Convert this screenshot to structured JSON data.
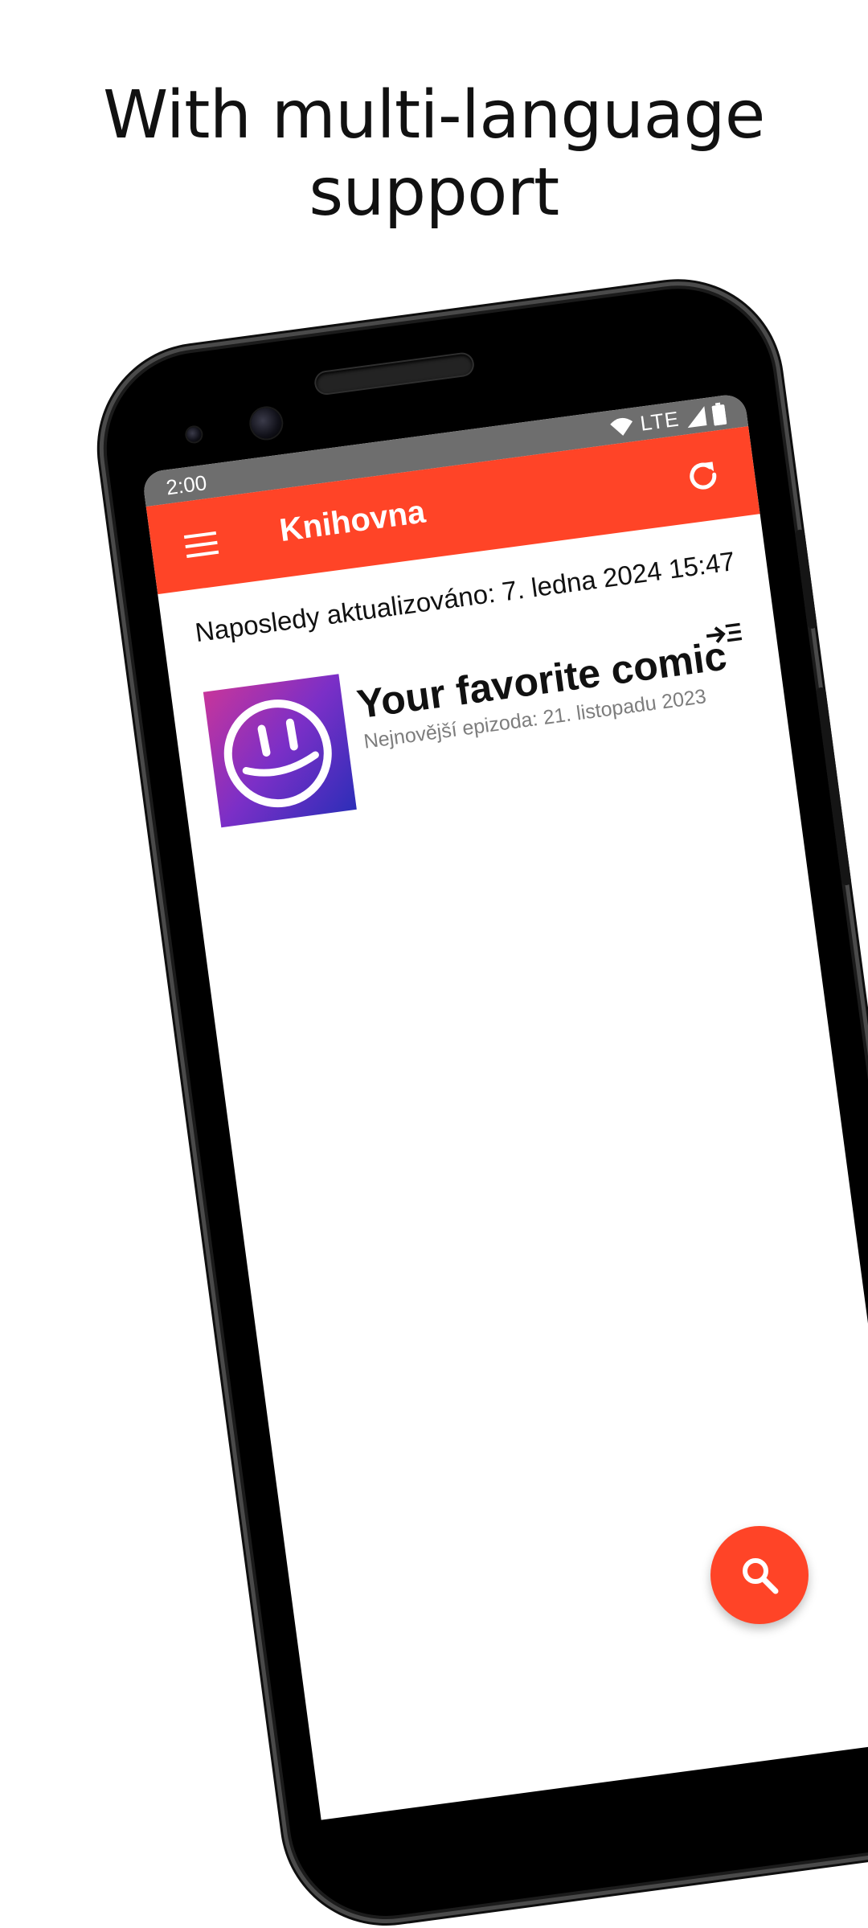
{
  "promo": {
    "headline_line1": "With multi-language",
    "headline_line2": "support"
  },
  "status_bar": {
    "time": "2:00",
    "network": "LTE",
    "icons": [
      "wifi-icon",
      "cell-signal-icon",
      "battery-icon"
    ]
  },
  "app_bar": {
    "title": "Knihovna",
    "menu_icon": "menu-icon",
    "refresh_icon": "refresh-icon",
    "color": "#ff4427"
  },
  "library": {
    "last_updated": "Naposledy aktualizováno: 7. ledna 2024 15:47",
    "comics": [
      {
        "title": "Your favorite comic",
        "latest_episode": "Nejnovější epizoda: 21. listopadu 2023",
        "cover_icon": "smiley-face-icon",
        "action_icon": "add-to-queue-icon"
      }
    ]
  },
  "fab": {
    "icon": "search-icon",
    "color": "#ff4427"
  }
}
